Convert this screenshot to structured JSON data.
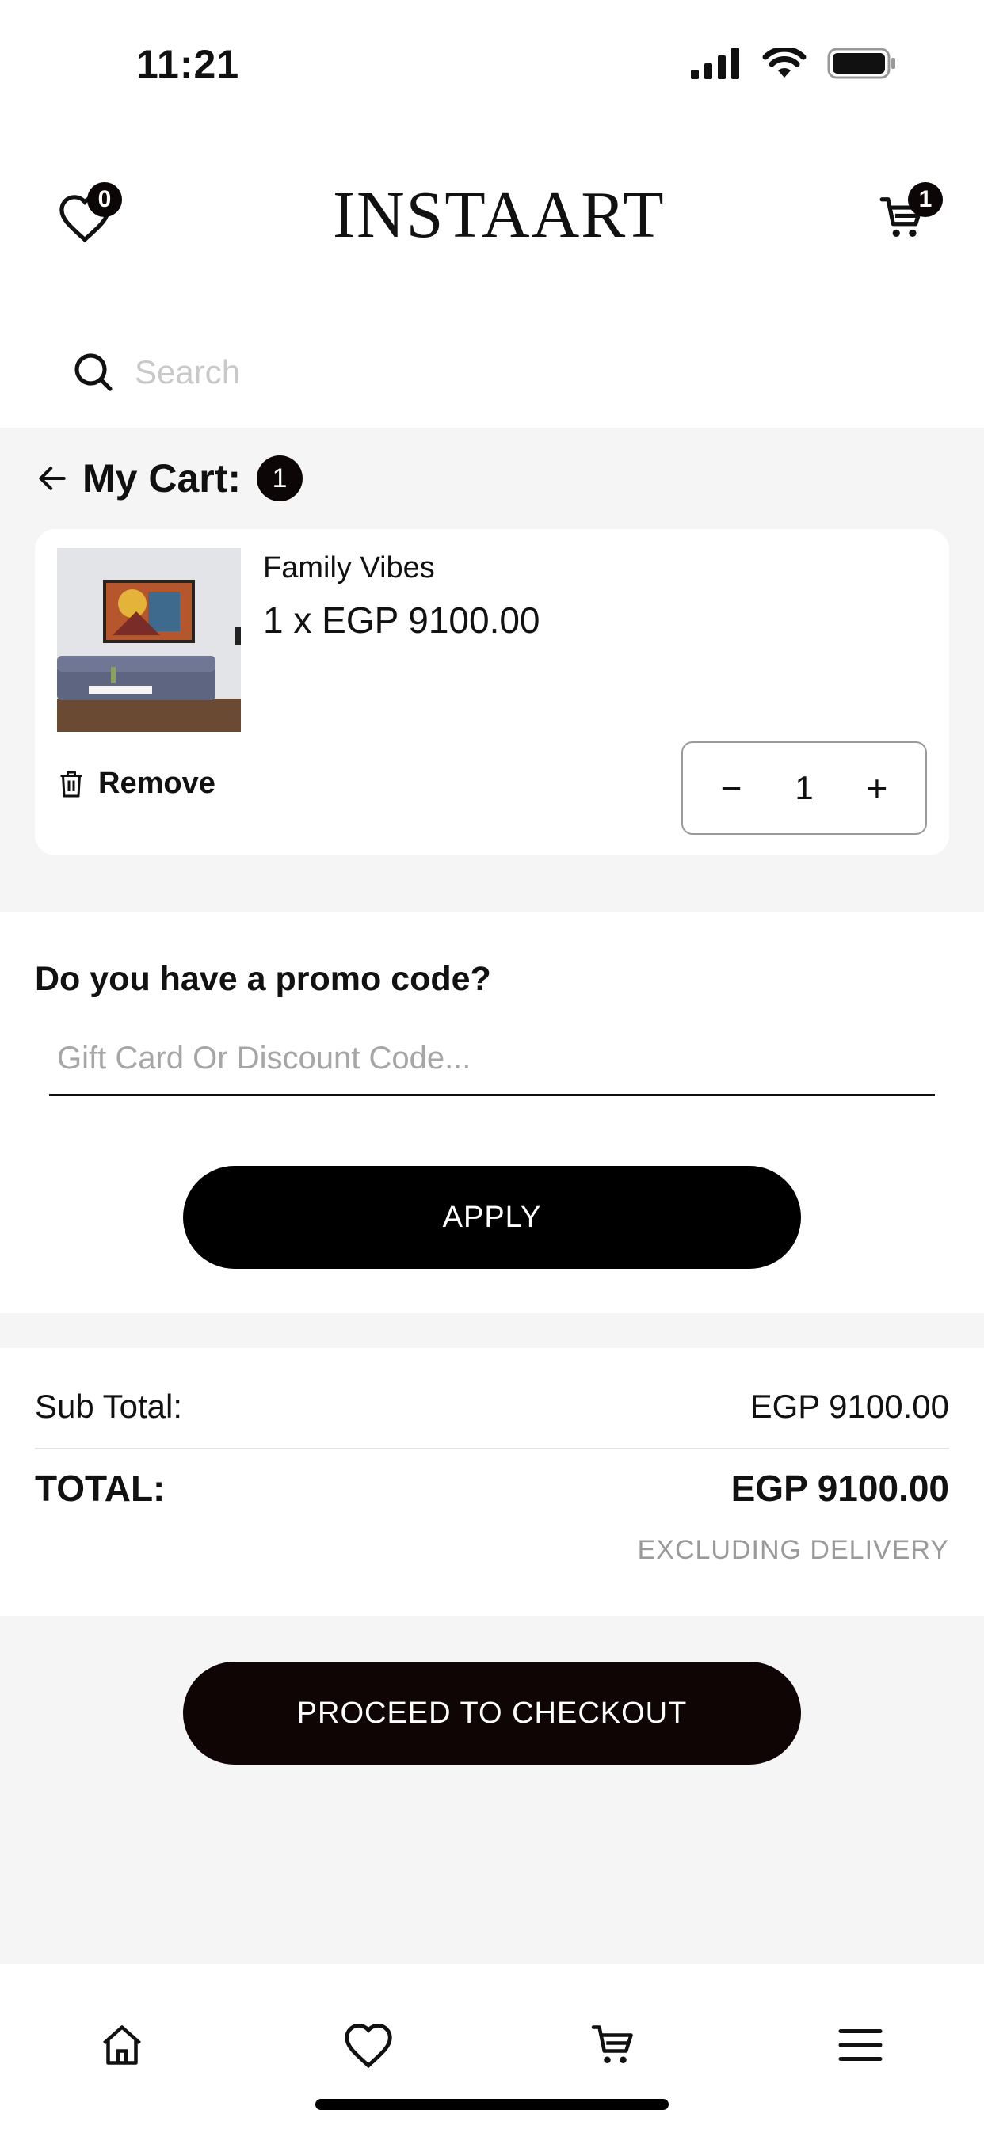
{
  "status_bar": {
    "time": "11:21"
  },
  "header": {
    "logo_text": "INSTAART",
    "wishlist_count": "0",
    "cart_count": "1"
  },
  "search": {
    "placeholder": "Search"
  },
  "cart": {
    "title": "My Cart:",
    "count": "1",
    "items": [
      {
        "name": "Family Vibes",
        "price_line": "1 x EGP 9100.00",
        "remove_label": "Remove",
        "quantity": "1"
      }
    ]
  },
  "promo": {
    "question": "Do you have a promo code?",
    "placeholder": "Gift Card Or Discount Code...",
    "apply_label": "APPLY"
  },
  "totals": {
    "subtotal_label": "Sub Total:",
    "subtotal_value": "EGP 9100.00",
    "total_label": "TOTAL:",
    "total_value": "EGP 9100.00",
    "note": "EXCLUDING DELIVERY"
  },
  "checkout": {
    "label": "PROCEED TO CHECKOUT"
  },
  "bottom_nav": {
    "items": [
      {
        "icon": "home-icon"
      },
      {
        "icon": "heart-icon"
      },
      {
        "icon": "cart-icon"
      },
      {
        "icon": "menu-icon"
      }
    ]
  },
  "colors": {
    "primary": "#000000",
    "background": "#f5f5f5",
    "card": "#ffffff",
    "muted": "#9a9a9a"
  }
}
